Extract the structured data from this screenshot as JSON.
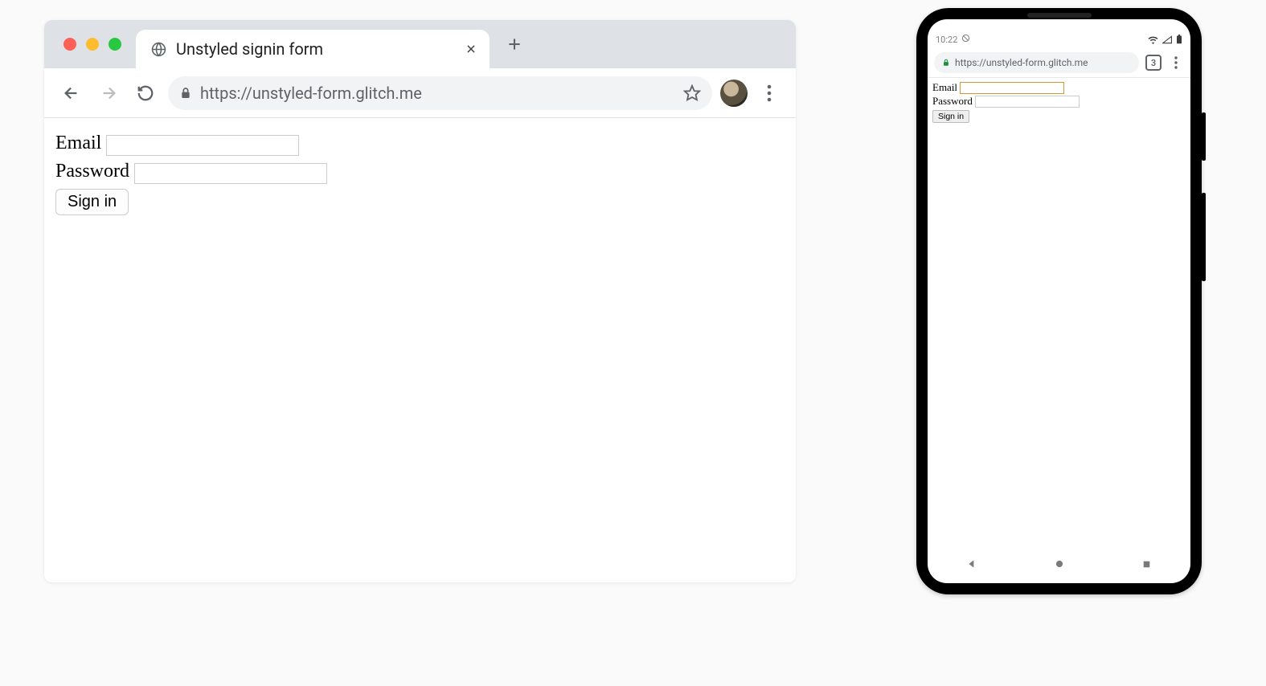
{
  "desktop": {
    "tab_title": "Unstyled signin form",
    "url": "https://unstyled-form.glitch.me",
    "form": {
      "email_label": "Email",
      "password_label": "Password",
      "signin_button": "Sign in"
    }
  },
  "phone": {
    "time": "10:22",
    "url": "https://unstyled-form.glitch.me",
    "tab_count": "3",
    "form": {
      "email_label": "Email",
      "password_label": "Password",
      "signin_button": "Sign in"
    }
  }
}
